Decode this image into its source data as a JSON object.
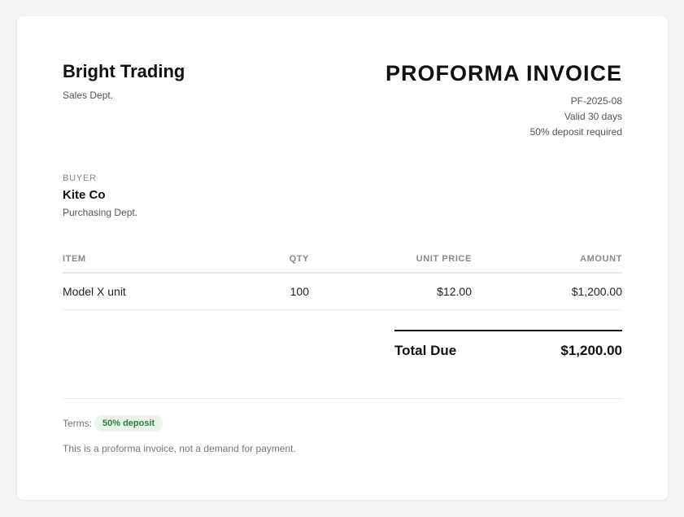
{
  "seller": {
    "name": "Bright Trading",
    "department": "Sales Dept."
  },
  "document": {
    "title": "PROFORMA INVOICE",
    "number": "PF-2025-08",
    "validity": "Valid 30 days",
    "deposit_note": "50% deposit required"
  },
  "buyer": {
    "label": "BUYER",
    "name": "Kite Co",
    "department": "Purchasing Dept."
  },
  "table": {
    "headers": {
      "item": "ITEM",
      "qty": "QTY",
      "unit_price": "UNIT PRICE",
      "amount": "AMOUNT"
    },
    "rows": [
      {
        "item": "Model X unit",
        "qty": "100",
        "unit_price": "$12.00",
        "amount": "$1,200.00"
      }
    ]
  },
  "totals": {
    "label": "Total Due",
    "value": "$1,200.00"
  },
  "footer": {
    "terms_label": "Terms:",
    "terms_badge": "50% deposit",
    "note": "This is a proforma invoice, not a demand for payment."
  },
  "colors": {
    "background": "#f4f4f4",
    "card": "#ffffff",
    "badge_bg": "#e9f5ea",
    "badge_text": "#2e7d32"
  }
}
